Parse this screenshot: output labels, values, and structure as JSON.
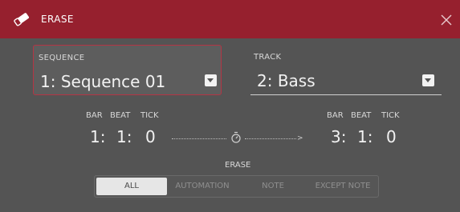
{
  "dialog": {
    "title": "ERASE",
    "title_icon": "eraser-icon",
    "close_icon": "close-icon"
  },
  "sequence": {
    "label": "SEQUENCE",
    "value": "1: Sequence 01"
  },
  "track": {
    "label": "TRACK",
    "value": "2: Bass"
  },
  "range": {
    "start": {
      "bar_label": "BAR",
      "beat_label": "BEAT",
      "tick_label": "TICK",
      "bar": "1:",
      "beat": "1:",
      "tick": "0"
    },
    "end": {
      "bar_label": "BAR",
      "beat_label": "BEAT",
      "tick_label": "TICK",
      "bar": "3:",
      "beat": "1:",
      "tick": "0"
    },
    "separator_icon": "timer-icon"
  },
  "erase": {
    "label": "ERASE",
    "options": [
      "ALL",
      "AUTOMATION",
      "NOTE",
      "EXCEPT NOTE"
    ],
    "selected": "ALL"
  },
  "colors": {
    "title_bar": "#96202e",
    "background": "#545454",
    "accent": "#b53444"
  }
}
